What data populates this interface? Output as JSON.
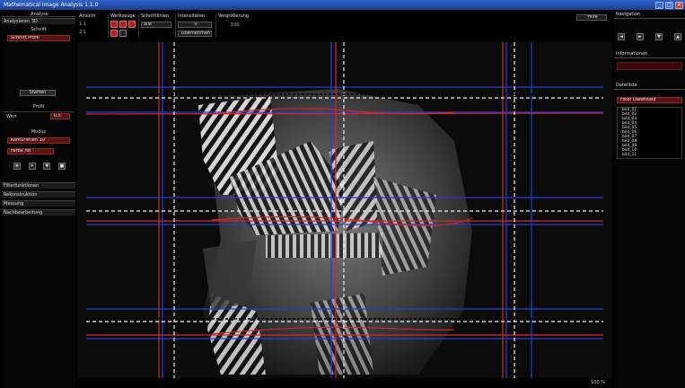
{
  "window": {
    "title": "Mathematical Image Analysis 1.1.0"
  },
  "left_panel": {
    "title": "Analyse",
    "section_header": "Analysieren 3D",
    "sub_label": "Schnitt",
    "object_field": "Schnitt Profil",
    "start_button": "Starten",
    "profile_label": "Profil",
    "value_label": "Wert",
    "value_input": "0.5",
    "mode_label": "Modus",
    "mode_select": "Konturlinien 10",
    "color_select": "Farbe rot",
    "collapsed_sections": [
      "Filterfunktionen",
      "Rekonstruktion",
      "Messung",
      "Nachbearbeitung"
    ]
  },
  "toolbar": {
    "groups": [
      {
        "label": "Ansicht",
        "lines": [
          "1:1",
          "2:1"
        ]
      },
      {
        "label": "Werkzeuge"
      },
      {
        "label": "Schnittlinien",
        "select": "alle"
      },
      {
        "label": "Intensitäten",
        "value": "0",
        "button": "Übernehmen"
      },
      {
        "label": "Vergrößerung",
        "value": "100"
      }
    ],
    "help_button": "Hilfe"
  },
  "right_panel": {
    "nav_title": "Navigation",
    "nav_buttons": [
      "◄",
      "►",
      "▼",
      "▲"
    ],
    "info_title": "Informationen",
    "list_title": "Dateiliste",
    "search_field": "Filter Datensatz",
    "files": [
      "bild_01",
      "bild_02",
      "bild_03",
      "bild_04",
      "bild_05",
      "bild_06",
      "bild_07",
      "bild_08",
      "bild_09",
      "bild_10",
      "bild_11",
      "bild_12"
    ]
  },
  "status": {
    "zoom_text": "100 %"
  },
  "colors": {
    "accent_red": "#c02020",
    "line_blue": "#2a3bd0",
    "line_red": "#d02a2a",
    "title_blue": "#1f4aa8",
    "panel_bg": "#050505"
  }
}
